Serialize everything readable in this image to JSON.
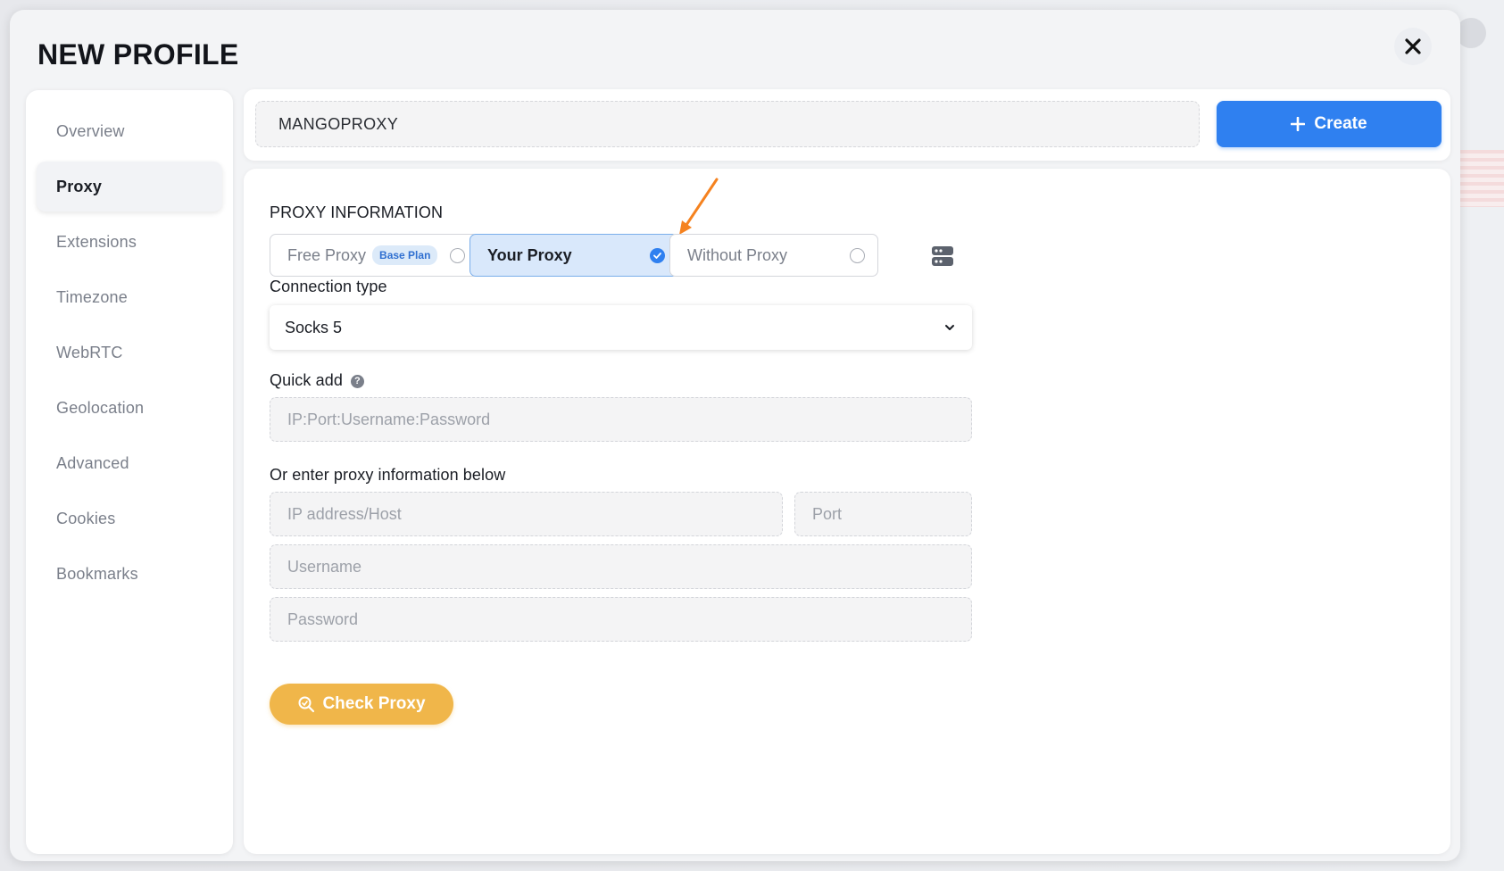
{
  "modal": {
    "title": "NEW PROFILE",
    "close_icon": "close-icon"
  },
  "sidebar": {
    "items": [
      {
        "label": "Overview",
        "active": false
      },
      {
        "label": "Proxy",
        "active": true
      },
      {
        "label": "Extensions",
        "active": false
      },
      {
        "label": "Timezone",
        "active": false
      },
      {
        "label": "WebRTC",
        "active": false
      },
      {
        "label": "Geolocation",
        "active": false
      },
      {
        "label": "Advanced",
        "active": false
      },
      {
        "label": "Cookies",
        "active": false
      },
      {
        "label": "Bookmarks",
        "active": false
      }
    ]
  },
  "topbar": {
    "profile_name": "MANGOPROXY",
    "create_label": "Create"
  },
  "proxy": {
    "section_title": "PROXY INFORMATION",
    "options": [
      {
        "label": "Free Proxy",
        "badge": "Base Plan",
        "selected": false
      },
      {
        "label": "Your Proxy",
        "selected": true
      },
      {
        "label": "Without Proxy",
        "selected": false
      }
    ],
    "connection_type_label": "Connection type",
    "connection_type_value": "Socks 5",
    "quick_add_label": "Quick add",
    "quick_add_placeholder": "IP:Port:Username:Password",
    "manual_label": "Or enter proxy information below",
    "host_placeholder": "IP address/Host",
    "port_placeholder": "Port",
    "username_placeholder": "Username",
    "password_placeholder": "Password",
    "check_label": "Check Proxy"
  },
  "colors": {
    "accent": "#2f80f0",
    "check_button": "#f0b64a",
    "annotation_arrow": "#f5821f"
  }
}
